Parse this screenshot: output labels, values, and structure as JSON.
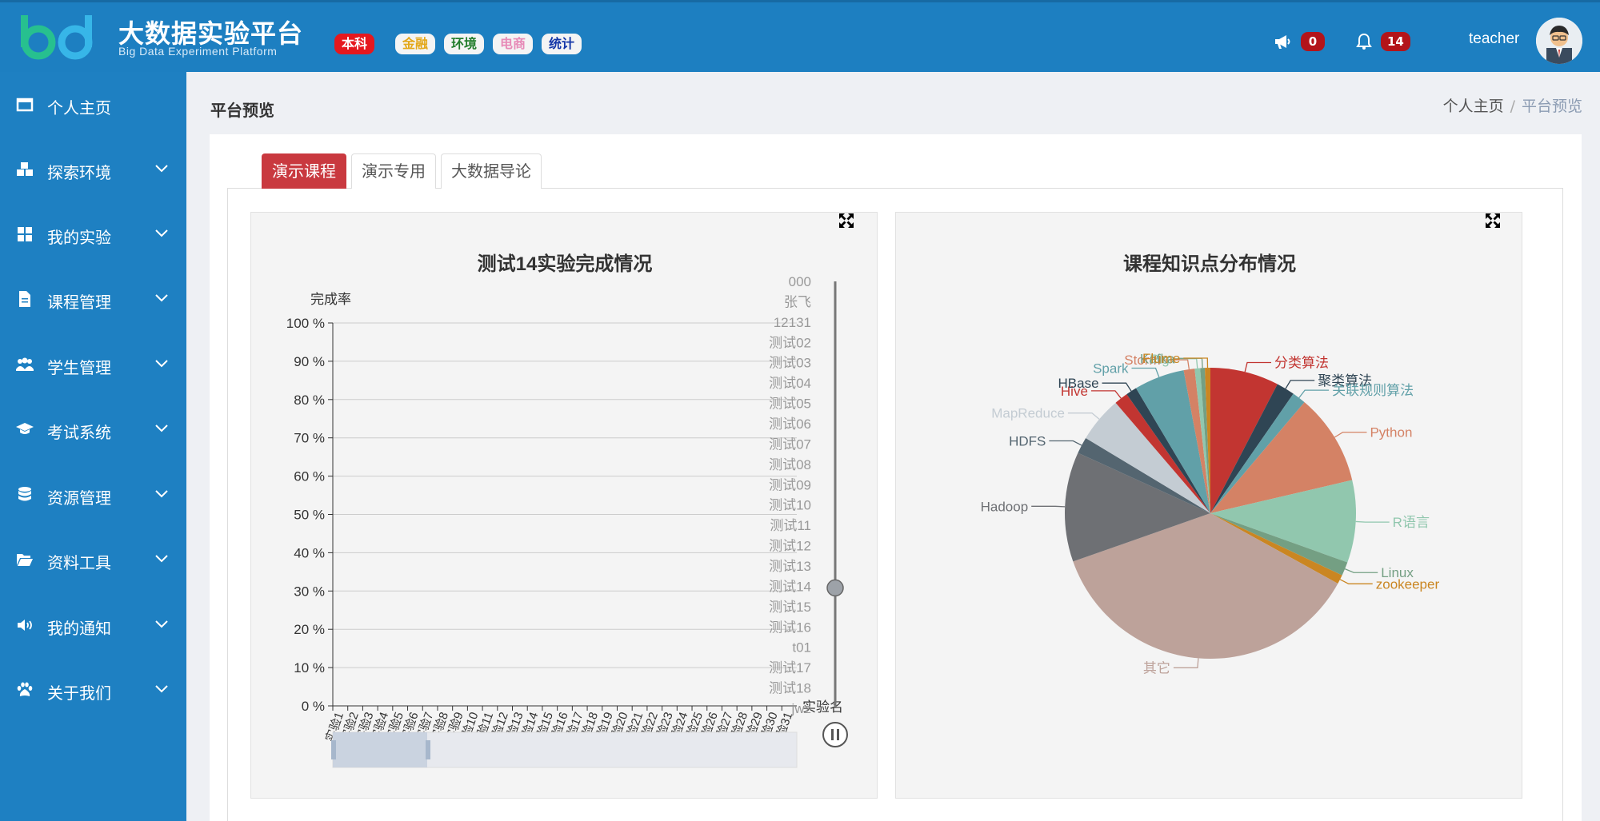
{
  "header": {
    "title": "大数据实验平台",
    "subtitle": "Big Data Experiment Platform",
    "tags": [
      "本科",
      "金融",
      "环境",
      "电商",
      "统计"
    ],
    "announcement_count": "0",
    "notification_count": "14",
    "username": "teacher"
  },
  "sidebar": {
    "items": [
      {
        "label": "个人主页",
        "icon": "window-icon"
      },
      {
        "label": "探索环境",
        "icon": "cubes-icon"
      },
      {
        "label": "我的实验",
        "icon": "grid-icon"
      },
      {
        "label": "课程管理",
        "icon": "file-icon"
      },
      {
        "label": "学生管理",
        "icon": "users-icon"
      },
      {
        "label": "考试系统",
        "icon": "graduation-cap-icon"
      },
      {
        "label": "资源管理",
        "icon": "database-icon"
      },
      {
        "label": "资料工具",
        "icon": "folder-open-icon"
      },
      {
        "label": "我的通知",
        "icon": "volume-icon"
      },
      {
        "label": "关于我们",
        "icon": "paw-icon"
      }
    ]
  },
  "page": {
    "title": "平台预览",
    "breadcrumb": [
      "个人主页",
      "平台预览"
    ]
  },
  "tabs": [
    {
      "label": "演示课程",
      "active": true
    },
    {
      "label": "演示专用",
      "active": false
    },
    {
      "label": "大数据导论",
      "active": false
    }
  ],
  "colors": {
    "brand": "#1d7fc1",
    "active_tab": "#c9393f",
    "badge": "#b3141a"
  },
  "chart_data": [
    {
      "type": "bar",
      "title": "测试14实验完成情况",
      "ylabel": "完成率",
      "xlabel": "实验名",
      "ylim": [
        0,
        100
      ],
      "yticks": [
        "0 %",
        "10 %",
        "20 %",
        "30 %",
        "40 %",
        "50 %",
        "60 %",
        "70 %",
        "80 %",
        "90 %",
        "100 %"
      ],
      "categories": [
        "实验1",
        "实验2",
        "实验3",
        "实验4",
        "实验5",
        "实验6",
        "实验7",
        "实验8",
        "实验9",
        "实验10",
        "实验11",
        "实验12",
        "实验13",
        "实验14",
        "实验15",
        "实验16",
        "实验17",
        "实验18",
        "实验19",
        "实验20",
        "实验21",
        "实验22",
        "实验23",
        "实验24",
        "实验25",
        "实验26",
        "实验27",
        "实验28",
        "实验29",
        "实验30",
        "实验31"
      ],
      "values": [
        0,
        0,
        0,
        0,
        0,
        0,
        0,
        0,
        0,
        0,
        0,
        0,
        0,
        0,
        0,
        0,
        0,
        0,
        0,
        0,
        0,
        0,
        0,
        0,
        0,
        0,
        0,
        0,
        0,
        0,
        0
      ],
      "timeline": [
        "000",
        "张飞",
        "12131",
        "测试02",
        "测试03",
        "测试04",
        "测试05",
        "测试06",
        "测试07",
        "测试08",
        "测试09",
        "测试10",
        "测试11",
        "测试12",
        "测试13",
        "测试14",
        "测试15",
        "测试16",
        "t01",
        "测试17",
        "测试18",
        "jwz"
      ],
      "timeline_current": "测试14",
      "grid": true
    },
    {
      "type": "pie",
      "title": "课程知识点分布情况",
      "slices": [
        {
          "name": "分类算法",
          "value": 7.5,
          "color": "#c23531"
        },
        {
          "name": "聚类算法",
          "value": 2.0,
          "color": "#2f4554"
        },
        {
          "name": "关联规则算法",
          "value": 1.5,
          "color": "#61a0a8"
        },
        {
          "name": "Python",
          "value": 10.0,
          "color": "#d48265"
        },
        {
          "name": "R语言",
          "value": 9.0,
          "color": "#91c7ae"
        },
        {
          "name": "Linux",
          "value": 1.5,
          "color": "#749f83"
        },
        {
          "name": "zookeeper",
          "value": 1.0,
          "color": "#ca8622"
        },
        {
          "name": "其它",
          "value": 36.0,
          "color": "#bda29a"
        },
        {
          "name": "Hadoop",
          "value": 12.0,
          "color": "#6e7074"
        },
        {
          "name": "HDFS",
          "value": 1.8,
          "color": "#546570"
        },
        {
          "name": "MapReduce",
          "value": 5.0,
          "color": "#c4ccd3"
        },
        {
          "name": "Hive",
          "value": 1.5,
          "color": "#c23531"
        },
        {
          "name": "HBase",
          "value": 1.2,
          "color": "#2f4554"
        },
        {
          "name": "Spark",
          "value": 5.5,
          "color": "#61a0a8"
        },
        {
          "name": "Storm",
          "value": 1.2,
          "color": "#d48265"
        },
        {
          "name": "Pig",
          "value": 0.6,
          "color": "#91c7ae"
        },
        {
          "name": "Kafka",
          "value": 0.5,
          "color": "#749f83"
        },
        {
          "name": "Flume",
          "value": 0.6,
          "color": "#ca8622"
        }
      ]
    }
  ]
}
